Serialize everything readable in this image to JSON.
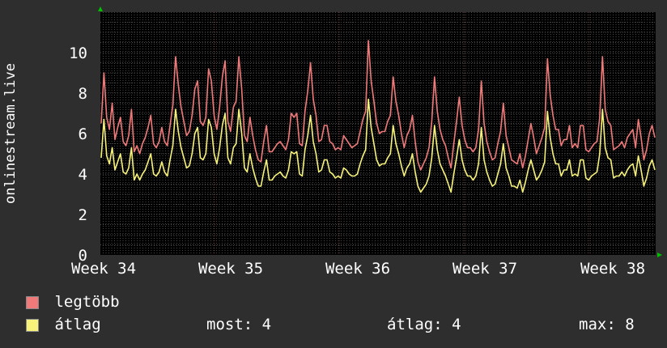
{
  "chart_data": {
    "type": "line",
    "title": "",
    "ylabel": "onlinestream.live",
    "xlabel": "",
    "ylim": [
      0,
      12
    ],
    "yticks": [
      0,
      2,
      4,
      6,
      8,
      10
    ],
    "x_ticks": [
      "Week 34",
      "Week 35",
      "Week 36",
      "Week 37",
      "Week 38"
    ],
    "grid": true,
    "colors": {
      "background": "#2e2e2e",
      "plot": "#000000",
      "grid": "#4a4a4a",
      "major_grid": "#7a3a3a",
      "max": "#f07a7a",
      "avg": "#f7f27a",
      "arrow": "#00c000"
    },
    "series": [
      {
        "name": "legtöbb",
        "color": "#f07a7a",
        "values": [
          6.5,
          9,
          6.8,
          6.2,
          7.5,
          5.7,
          6.3,
          6.8,
          5.6,
          5.4,
          5.9,
          7.2,
          5.1,
          5.4,
          5,
          5.5,
          5.8,
          6.3,
          6.9,
          5.5,
          5.3,
          5.6,
          6.3,
          5.6,
          5.4,
          6.4,
          7.4,
          9.8,
          8.4,
          7.3,
          6.6,
          5.9,
          6.1,
          6.9,
          8.2,
          8.6,
          6.6,
          6.4,
          6.8,
          9.2,
          8.6,
          6.9,
          6.2,
          7.3,
          8.8,
          9.6,
          6.6,
          6.1,
          7.3,
          7.6,
          9.8,
          8.2,
          5.9,
          5.6,
          6.8,
          5.9,
          5.2,
          4.7,
          4.6,
          5.6,
          6.4,
          5.1,
          5.1,
          5.3,
          5.5,
          5.6,
          5.4,
          5.2,
          5.7,
          7,
          6.8,
          7,
          5.5,
          5.4,
          7.1,
          8.1,
          9.5,
          7.7,
          6.9,
          5.6,
          5.7,
          6.4,
          6.4,
          5.6,
          5.5,
          5.2,
          5.3,
          5.2,
          5.9,
          5.7,
          5.5,
          5.3,
          5.4,
          5.5,
          6.1,
          6.7,
          7.1,
          10.6,
          8.6,
          7.6,
          6.5,
          6,
          6.1,
          6.1,
          6.6,
          6.9,
          8.8,
          7.6,
          6.9,
          6,
          5.3,
          5.9,
          6.2,
          6.9,
          5.6,
          4.6,
          4.2,
          4.5,
          4.8,
          5.3,
          6.6,
          8.8,
          7.1,
          6.2,
          5.7,
          5.4,
          4.8,
          4.3,
          5.5,
          6.6,
          7.8,
          6.4,
          5.7,
          5.3,
          5.3,
          5.1,
          5.3,
          6.2,
          8.6,
          6.5,
          5.6,
          5.1,
          4.7,
          4.8,
          5.5,
          6.1,
          7.5,
          5.9,
          5.3,
          4.7,
          4.6,
          4.5,
          5,
          4.3,
          4.9,
          5.7,
          6.5,
          5.8,
          5,
          5.4,
          5.8,
          6.3,
          9.7,
          7.9,
          6.9,
          6.2,
          6.2,
          5.4,
          5.7,
          5.7,
          6.4,
          5.3,
          5.5,
          5.3,
          6.4,
          6.4,
          5.2,
          5.1,
          5.3,
          5.5,
          5.6,
          6.8,
          9.8,
          7.2,
          6.6,
          6.4,
          5.2,
          5.3,
          5.4,
          5.6,
          5.3,
          5.8,
          6,
          6.2,
          5.3,
          6.7,
          5.8,
          4.7,
          5.2,
          6,
          6.4,
          5.8
        ]
      },
      {
        "name": "átlag",
        "color": "#f7f27a",
        "values": [
          4.8,
          6.7,
          4.9,
          4.5,
          5.3,
          4.2,
          4.6,
          5,
          4.1,
          4,
          4.3,
          5.3,
          3.7,
          4,
          3.7,
          4,
          4.2,
          4.6,
          5,
          4,
          3.9,
          4.1,
          4.6,
          4.1,
          3.9,
          4.7,
          5.4,
          7.2,
          6.1,
          5.3,
          4.8,
          4.3,
          4.4,
          5,
          6,
          6.3,
          4.8,
          4.7,
          5,
          6.7,
          6.3,
          5,
          4.5,
          5.3,
          6.4,
          7,
          4.8,
          4.5,
          5.3,
          5.5,
          7.2,
          6,
          4.3,
          4.1,
          5,
          4.3,
          3.8,
          3.4,
          3.4,
          4.1,
          4.7,
          3.7,
          3.7,
          3.9,
          4,
          4.1,
          3.9,
          3.8,
          4.2,
          5.1,
          5,
          5.1,
          4,
          3.9,
          5.2,
          5.9,
          6.9,
          5.6,
          5,
          4.1,
          4.2,
          4.7,
          4.7,
          4.1,
          4,
          3.8,
          3.9,
          3.8,
          4.3,
          4.2,
          4,
          3.9,
          3.9,
          4,
          4.5,
          4.9,
          5.2,
          7.7,
          6.3,
          5.5,
          4.7,
          4.4,
          4.5,
          4.5,
          4.8,
          5,
          6.4,
          5.5,
          5,
          4.4,
          3.9,
          4.3,
          4.5,
          5,
          4.1,
          3.4,
          3.1,
          3.3,
          3.5,
          3.9,
          4.8,
          6.4,
          5.2,
          4.5,
          4.2,
          3.9,
          3.5,
          3.1,
          4,
          4.8,
          5.7,
          4.7,
          4.2,
          3.9,
          3.9,
          3.7,
          3.9,
          4.5,
          6.3,
          4.7,
          4.1,
          3.7,
          3.4,
          3.5,
          4,
          4.5,
          5.5,
          4.3,
          3.9,
          3.4,
          3.4,
          3.3,
          3.7,
          3.1,
          3.6,
          4.2,
          4.7,
          4.2,
          3.7,
          3.9,
          4.2,
          4.6,
          7.1,
          5.8,
          5,
          4.5,
          4.5,
          3.9,
          4.2,
          4.2,
          4.7,
          3.9,
          4,
          3.9,
          4.7,
          4.7,
          3.8,
          3.7,
          3.9,
          4,
          4.1,
          5,
          7.2,
          5.3,
          4.8,
          4.7,
          3.8,
          3.9,
          3.9,
          4.1,
          3.9,
          4.2,
          4.4,
          4.5,
          3.9,
          4.9,
          4.2,
          3.4,
          3.8,
          4.4,
          4.7,
          4.2
        ]
      }
    ]
  },
  "legend": {
    "items": [
      {
        "label": "legtöbb",
        "color": "#f07a7a"
      },
      {
        "label": "átlag",
        "color": "#f7f27a"
      }
    ],
    "stats": {
      "most_label": "most:",
      "most_value": "4",
      "atlag_label": "átlag:",
      "atlag_value": "4",
      "max_label": "max:",
      "max_value": "8"
    }
  }
}
